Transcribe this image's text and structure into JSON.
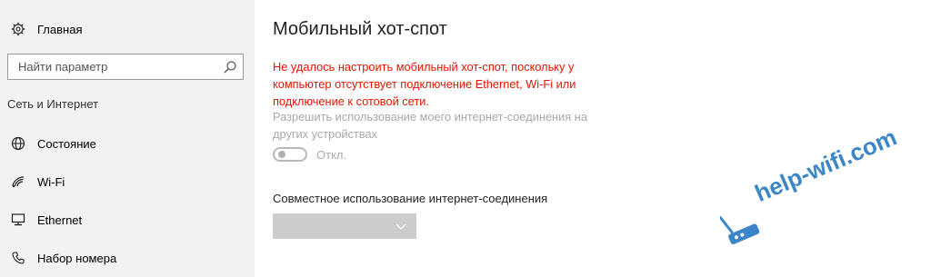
{
  "sidebar": {
    "home_label": "Главная",
    "search": {
      "placeholder": "Найти параметр"
    },
    "section_title": "Сеть и Интернет",
    "items": [
      {
        "label": "Состояние",
        "icon": "globe-icon"
      },
      {
        "label": "Wi-Fi",
        "icon": "wifi-icon"
      },
      {
        "label": "Ethernet",
        "icon": "ethernet-icon"
      },
      {
        "label": "Набор номера",
        "icon": "phone-icon"
      }
    ]
  },
  "main": {
    "title": "Мобильный хот-спот",
    "error": "Не удалось настроить мобильный хот-спот, поскольку у компьютер отсутствует подключение Ethernet, Wi-Fi или подключение к сотовой сети.",
    "share_description": "Разрешить использование моего интернет-соединения на других устройствах",
    "toggle_state": "Откл.",
    "share_connection_label": "Совместное использование интернет-соединения",
    "dropdown_value": ""
  },
  "watermark": {
    "text": "help-wifi.com"
  },
  "colors": {
    "error": "#e51400",
    "sidebar_bg": "#f2f2f2",
    "watermark": "#3c86c8"
  }
}
